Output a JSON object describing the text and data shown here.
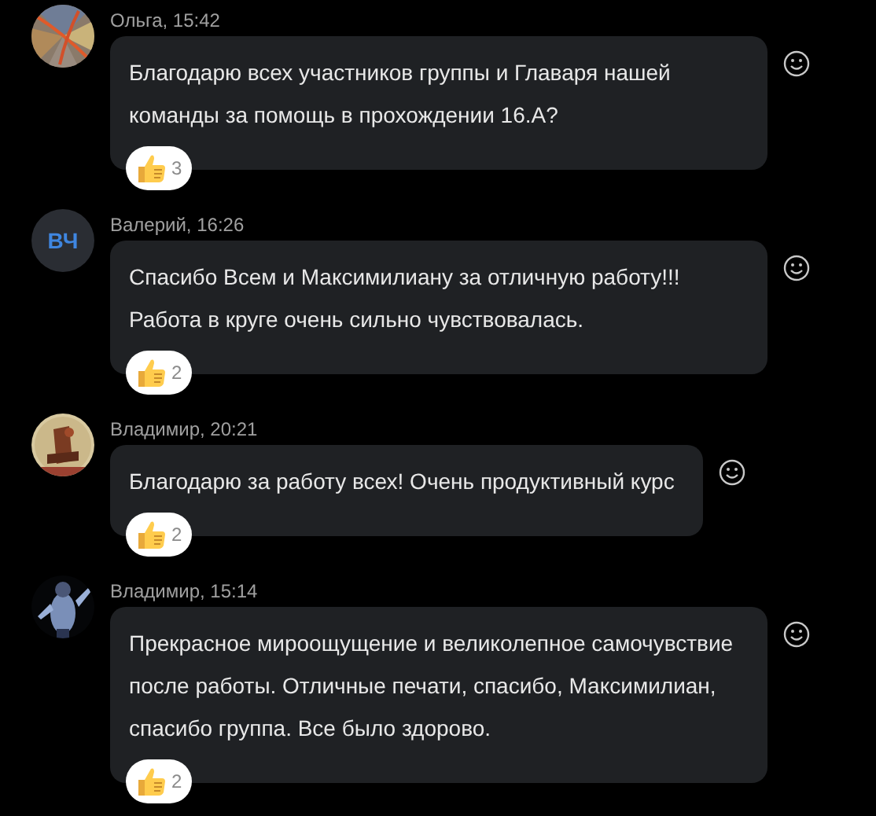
{
  "messages": [
    {
      "author": "Ольга, 15:42",
      "text": "Благодарю всех  участников группы и Главаря нашей команды  за помощь в прохождении 16.А?",
      "reaction": {
        "count": "3"
      }
    },
    {
      "author": "Валерий, 16:26",
      "avatar": {
        "kind": "initials",
        "initials": "ВЧ"
      },
      "text": "Спасибо Всем и Максимилиану за отличную работу!!! Работа в круге очень сильно чувствовалась.",
      "reaction": {
        "count": "2"
      }
    },
    {
      "author": "Владимир, 20:21",
      "text": "Благодарю за работу всех! Очень продуктивный курс",
      "reaction": {
        "count": "2"
      }
    },
    {
      "author": "Владимир, 15:14",
      "text": "Прекрасное мироощущение и великолепное самочувствие после работы. Отличные печати, спасибо, Максимилиан, спасибо группа. Все было здорово.",
      "reaction": {
        "count": "2"
      }
    }
  ]
}
